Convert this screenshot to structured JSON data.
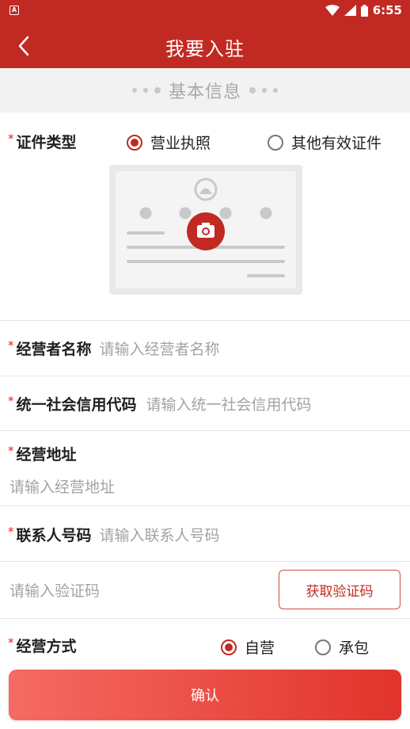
{
  "status_bar": {
    "time": "6:55",
    "app_badge": "A"
  },
  "header": {
    "title": "我要入驻"
  },
  "section": {
    "title": "基本信息"
  },
  "cert_type": {
    "label": "证件类型",
    "options": [
      "营业执照",
      "其他有效证件"
    ],
    "selected": "营业执照"
  },
  "upload": {
    "icon": "camera-icon"
  },
  "operator_name": {
    "label": "经营者名称",
    "placeholder": "请输入经营者名称"
  },
  "credit_code": {
    "label": "统一社会信用代码",
    "placeholder": "请输入统一社会信用代码"
  },
  "address": {
    "label": "经营地址",
    "placeholder": "请输入经营地址"
  },
  "contact_phone": {
    "label": "联系人号码",
    "placeholder": "请输入联系人号码"
  },
  "verification": {
    "placeholder": "请输入验证码",
    "button": "获取验证码"
  },
  "business_mode": {
    "label": "经营方式",
    "options": [
      "自营",
      "承包"
    ],
    "selected": "自营"
  },
  "confirm": {
    "label": "确认"
  },
  "colors": {
    "brand": "#c02a22",
    "accent_gradient_start": "#f56b63",
    "accent_gradient_end": "#e1332b"
  }
}
